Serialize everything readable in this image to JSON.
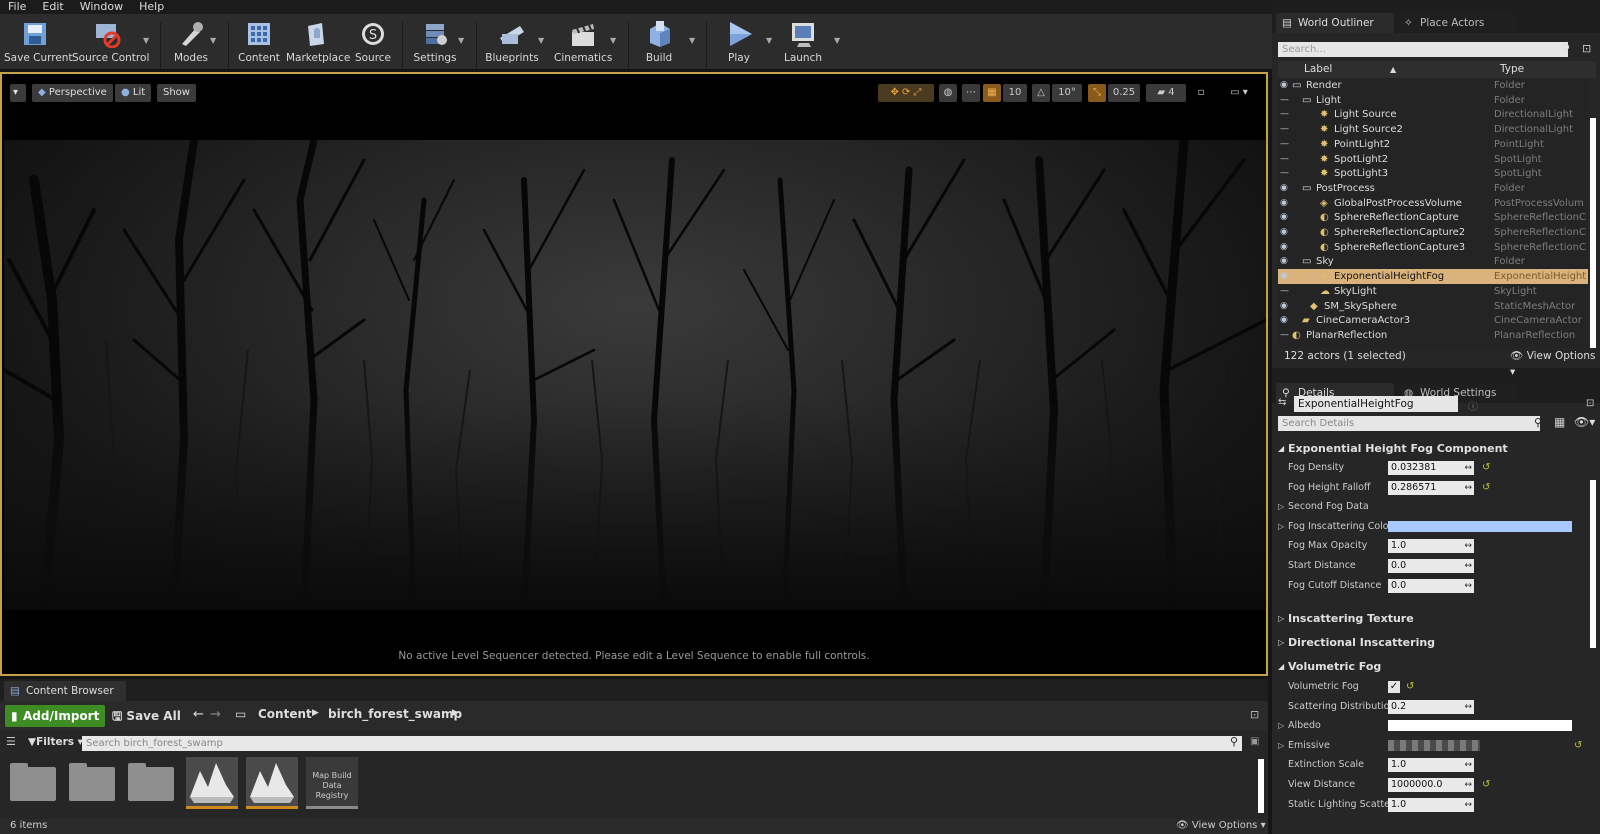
{
  "menu": [
    "File",
    "Edit",
    "Window",
    "Help"
  ],
  "toolbar": [
    {
      "label": "Save Current",
      "icon": "save-icon"
    },
    {
      "label": "Source Control",
      "icon": "source-control-icon"
    },
    {
      "label": "Modes",
      "icon": "modes-icon"
    },
    {
      "label": "Content",
      "icon": "content-icon"
    },
    {
      "label": "Marketplace",
      "icon": "marketplace-icon"
    },
    {
      "label": "Source",
      "icon": "source-icon"
    },
    {
      "label": "Settings",
      "icon": "settings-icon"
    },
    {
      "label": "Blueprints",
      "icon": "blueprints-icon"
    },
    {
      "label": "Cinematics",
      "icon": "cinematics-icon"
    },
    {
      "label": "Build",
      "icon": "build-icon"
    },
    {
      "label": "Play",
      "icon": "play-icon"
    },
    {
      "label": "Launch",
      "icon": "launch-icon"
    }
  ],
  "viewport": {
    "perspective": "Perspective",
    "lit": "Lit",
    "show": "Show",
    "grid_snap": "10",
    "rot_snap": "10°",
    "scale_snap": "0.25",
    "camera_speed": "4",
    "message": "No active Level Sequencer detected. Please edit a Level Sequence to enable full controls."
  },
  "content_browser": {
    "tab": "Content Browser",
    "add_import": "Add/Import",
    "save_all": "Save All",
    "path": [
      "Content",
      "birch_forest_swamp"
    ],
    "filters": "Filters",
    "search_placeholder": "Search birch_forest_swamp",
    "asset_label": "Map Build Data Registry",
    "items_count": "6 items",
    "view_options": "View Options"
  },
  "outliner": {
    "tab": "World Outliner",
    "tab2": "Place Actors",
    "search_placeholder": "Search...",
    "col_label": "Label",
    "col_type": "Type",
    "rows": [
      {
        "label": "Render",
        "type": "Folder"
      },
      {
        "label": "Light",
        "type": "Folder"
      },
      {
        "label": "Light Source",
        "type": "DirectionalLight"
      },
      {
        "label": "Light Source2",
        "type": "DirectionalLight"
      },
      {
        "label": "PointLight2",
        "type": "PointLight"
      },
      {
        "label": "SpotLight2",
        "type": "SpotLight"
      },
      {
        "label": "SpotLight3",
        "type": "SpotLight"
      },
      {
        "label": "PostProcess",
        "type": "Folder"
      },
      {
        "label": "GlobalPostProcessVolume",
        "type": "PostProcessVolum"
      },
      {
        "label": "SphereReflectionCapture",
        "type": "SphereReflectionC"
      },
      {
        "label": "SphereReflectionCapture2",
        "type": "SphereReflectionC"
      },
      {
        "label": "SphereReflectionCapture3",
        "type": "SphereReflectionC"
      },
      {
        "label": "Sky",
        "type": "Folder"
      },
      {
        "label": "ExponentialHeightFog",
        "type": "ExponentialHeight"
      },
      {
        "label": "SkyLight",
        "type": "SkyLight"
      },
      {
        "label": "SM_SkySphere",
        "type": "StaticMeshActor"
      },
      {
        "label": "CineCameraActor3",
        "type": "CineCameraActor"
      },
      {
        "label": "PlanarReflection",
        "type": "PlanarReflection"
      }
    ],
    "status": "122 actors (1 selected)",
    "view_options": "View Options"
  },
  "details": {
    "tab": "Details",
    "tab2": "World Settings",
    "name": "ExponentialHeightFog",
    "search_placeholder": "Search Details",
    "category1": "Exponential Height Fog Component",
    "props": [
      {
        "label": "Fog Density",
        "value": "0.032381"
      },
      {
        "label": "Fog Height Falloff",
        "value": "0.286571"
      },
      {
        "label": "Second Fog Data",
        "value": ""
      },
      {
        "label": "Fog Inscattering Color",
        "value": ""
      },
      {
        "label": "Fog Max Opacity",
        "value": "1.0"
      },
      {
        "label": "Start Distance",
        "value": "0.0"
      },
      {
        "label": "Fog Cutoff Distance",
        "value": "0.0"
      }
    ],
    "category2": "Inscattering Texture",
    "category3": "Directional Inscattering",
    "category4": "Volumetric Fog",
    "vprops": [
      {
        "label": "Volumetric Fog",
        "value": "✓"
      },
      {
        "label": "Scattering Distribution",
        "value": "0.2"
      },
      {
        "label": "Albedo",
        "value": ""
      },
      {
        "label": "Emissive",
        "value": ""
      },
      {
        "label": "Extinction Scale",
        "value": "1.0"
      },
      {
        "label": "View Distance",
        "value": "1000000.0"
      },
      {
        "label": "Static Lighting Scatteri",
        "value": "1.0"
      }
    ],
    "inscatter_color": "#a9c8ff"
  }
}
